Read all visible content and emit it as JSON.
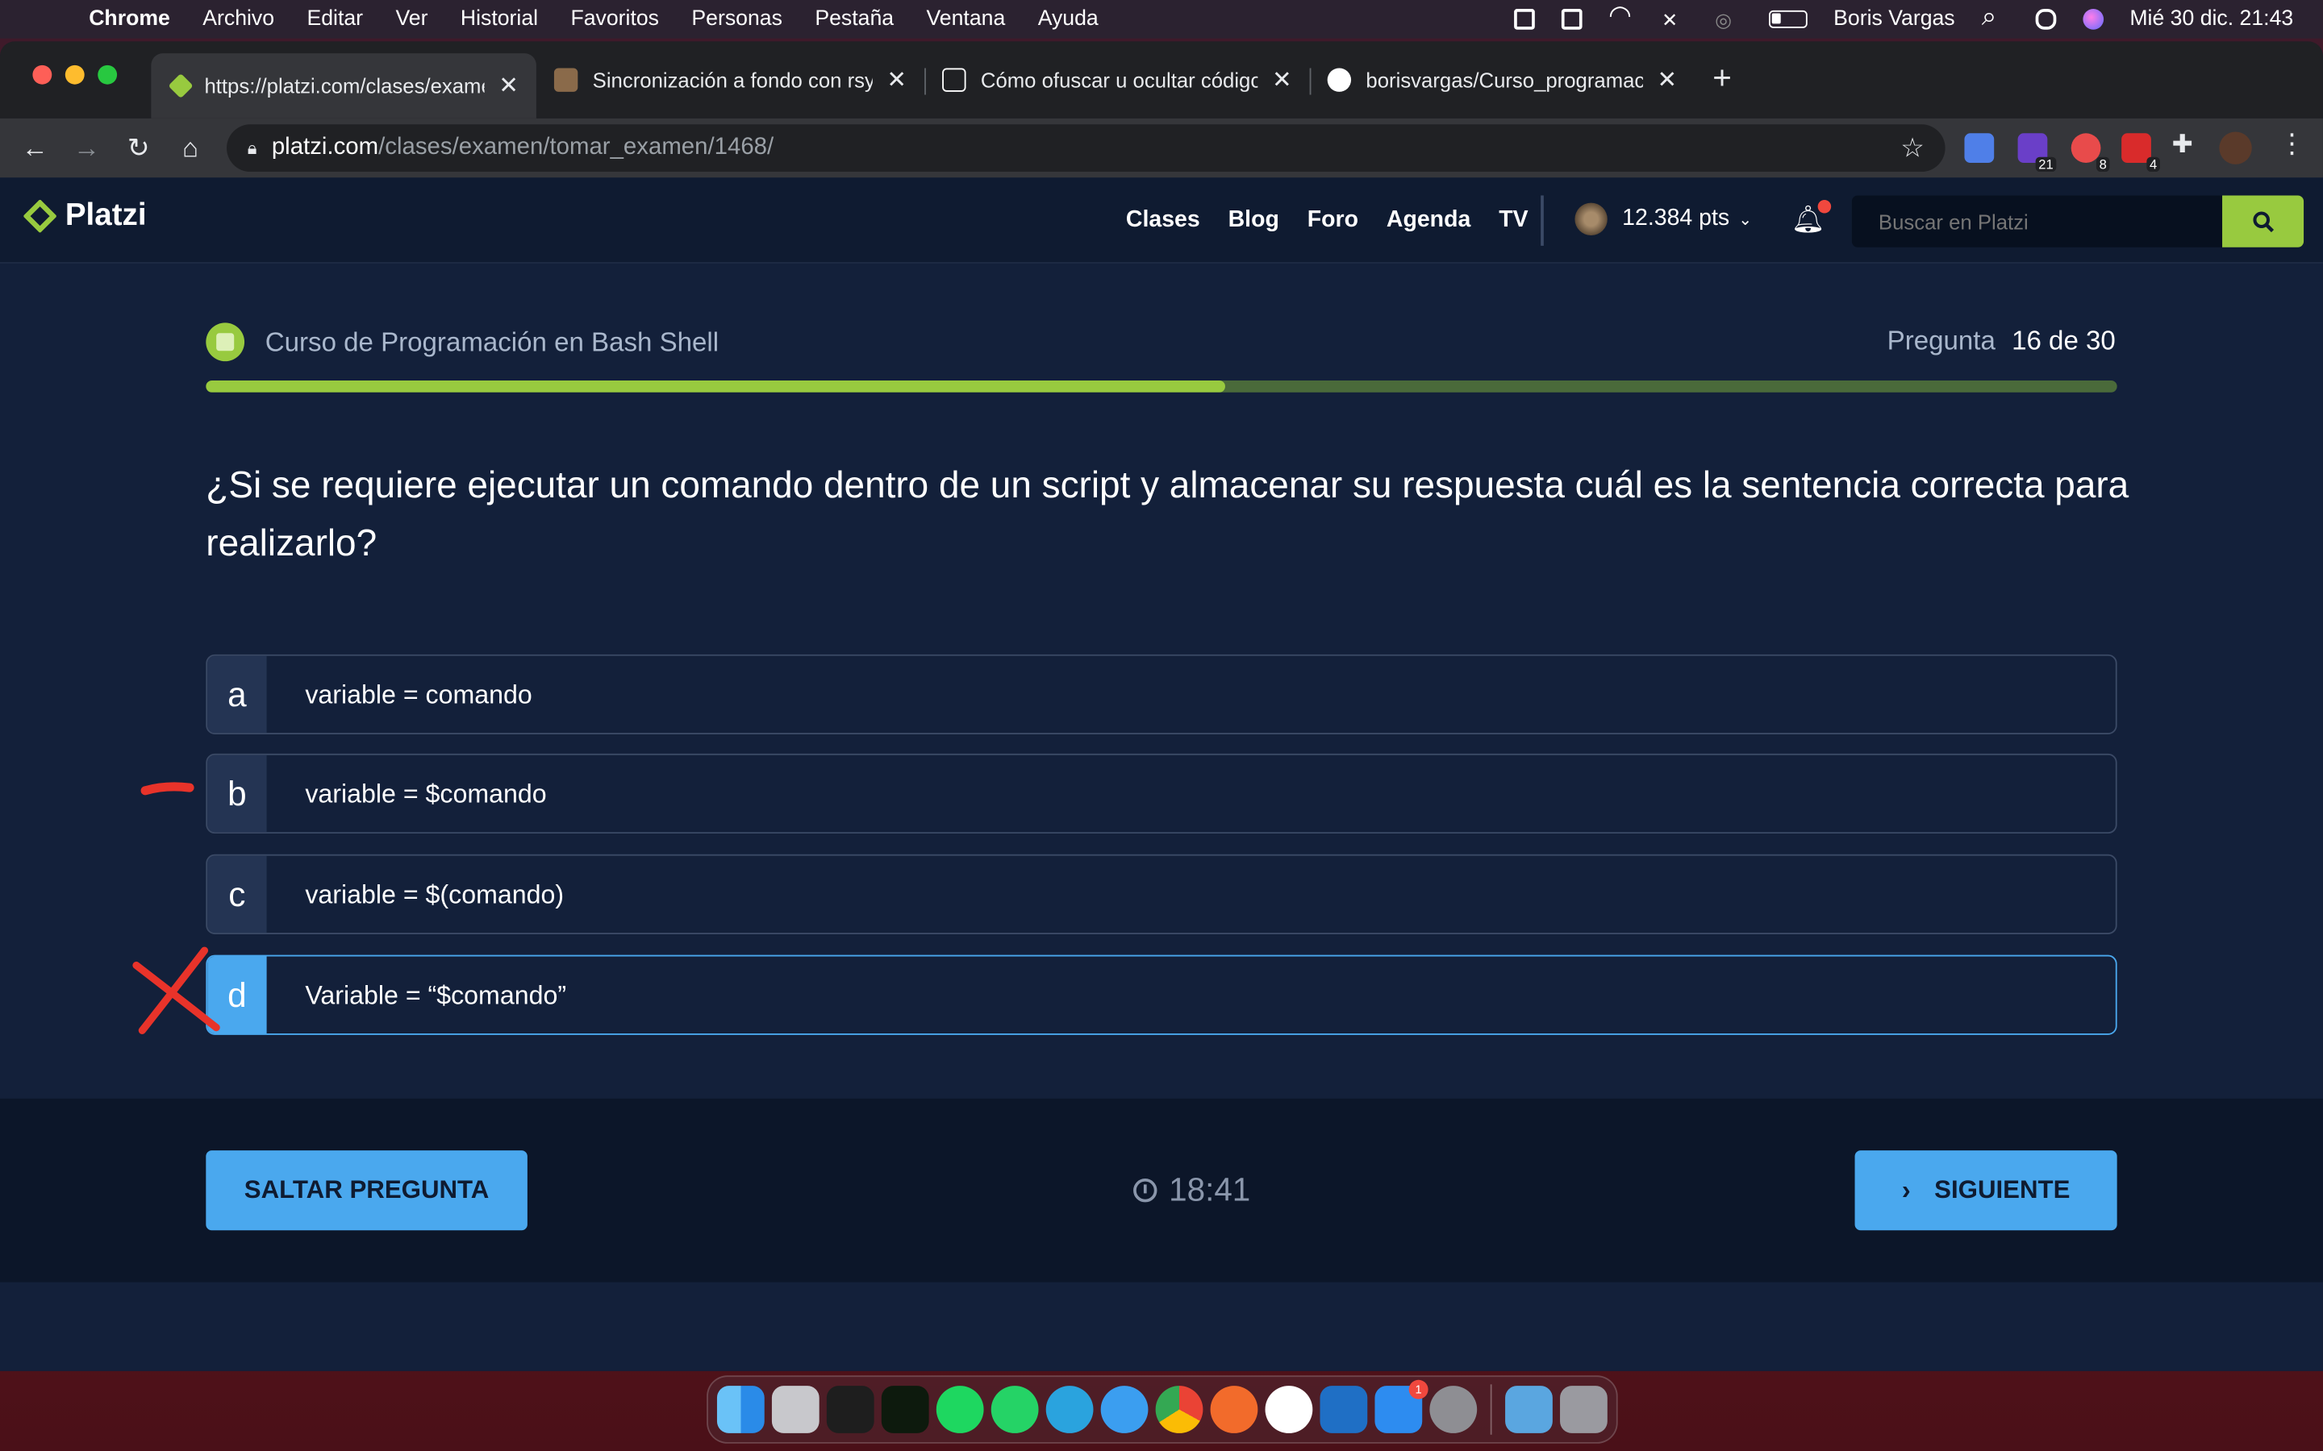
{
  "menubar": {
    "app_name": "Chrome",
    "items": [
      "Archivo",
      "Editar",
      "Ver",
      "Historial",
      "Favoritos",
      "Personas",
      "Pestaña",
      "Ventana",
      "Ayuda"
    ],
    "user_name": "Boris Vargas",
    "datetime": "Mié 30 dic.  21:43"
  },
  "browser": {
    "tabs": [
      {
        "title": "https://platzi.com/clases/examen",
        "favicon_color": "#98ca3f"
      },
      {
        "title": "Sincronización a fondo con rsync",
        "favicon_color": "#8a6a4a"
      },
      {
        "title": "Cómo ofuscar u ocultar código",
        "favicon_color": "#ffffff"
      },
      {
        "title": "borisvargas/Curso_programacion",
        "favicon_color": "#ffffff"
      }
    ],
    "url_host": "platzi.com",
    "url_path": "/clases/examen/tomar_examen/1468/",
    "extension_badges": [
      "21",
      "8",
      "4"
    ]
  },
  "site": {
    "logo_text": "Platzi",
    "nav": [
      "Clases",
      "Blog",
      "Foro",
      "Agenda",
      "TV"
    ],
    "points": "12.384 pts",
    "search_placeholder": "Buscar en Platzi"
  },
  "exam": {
    "course_name": "Curso de Programación en Bash Shell",
    "question_label": "Pregunta",
    "question_progress": "16 de 30",
    "progress_fraction": 0.533,
    "question": "¿Si se requiere ejecutar un comando dentro de un script y almacenar su respuesta cuál es la sentencia correcta para realizarlo?",
    "options": [
      {
        "letter": "a",
        "text": "variable = comando",
        "selected": false
      },
      {
        "letter": "b",
        "text": "variable = $comando",
        "selected": false
      },
      {
        "letter": "c",
        "text": "variable = $(comando)",
        "selected": false
      },
      {
        "letter": "d",
        "text": "Variable = “$comando”",
        "selected": true
      }
    ],
    "skip_label": "SALTAR PREGUNTA",
    "timer": "18:41",
    "next_label": "SIGUIENTE"
  },
  "colors": {
    "accent_green": "#98ca3f",
    "accent_blue": "#4aa8ee",
    "annotation_red": "#e8332a"
  }
}
